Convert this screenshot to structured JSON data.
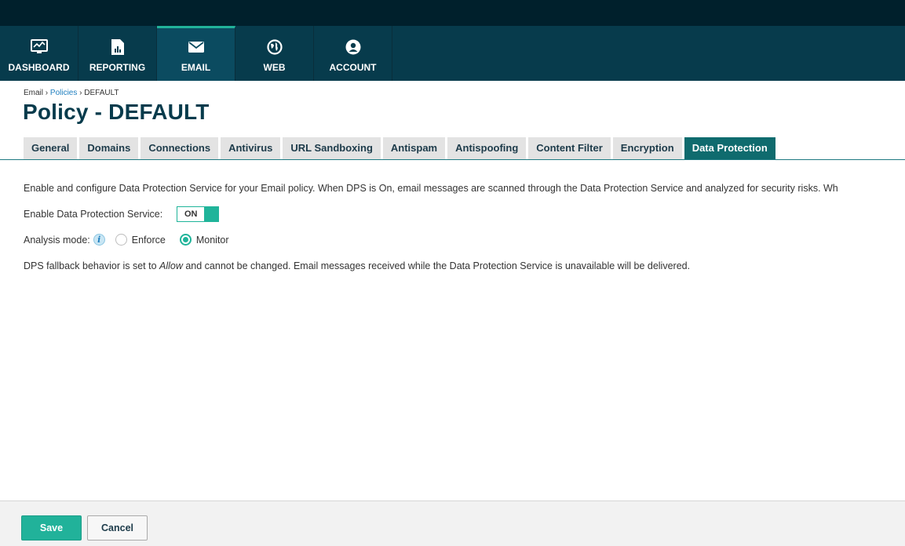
{
  "nav": {
    "items": [
      {
        "label": "DASHBOARD",
        "icon": "monitor-icon"
      },
      {
        "label": "REPORTING",
        "icon": "report-icon"
      },
      {
        "label": "EMAIL",
        "icon": "envelope-icon"
      },
      {
        "label": "WEB",
        "icon": "globe-icon"
      },
      {
        "label": "ACCOUNT",
        "icon": "user-icon"
      }
    ],
    "active": "EMAIL"
  },
  "breadcrumb": {
    "root": "Email",
    "sep1": " › ",
    "link": "Policies",
    "sep2": " › ",
    "current": "DEFAULT"
  },
  "title": "Policy - DEFAULT",
  "tabs": [
    "General",
    "Domains",
    "Connections",
    "Antivirus",
    "URL Sandboxing",
    "Antispam",
    "Antispoofing",
    "Content Filter",
    "Encryption",
    "Data Protection"
  ],
  "active_tab": "Data Protection",
  "content": {
    "intro": "Enable and configure Data Protection Service for your Email policy. When DPS is On, email messages are scanned through the Data Protection Service and analyzed for security risks. Wh",
    "enable_label": "Enable Data Protection Service:",
    "toggle_label": "ON",
    "analysis_label": "Analysis mode:",
    "info_glyph": "i",
    "mode_options": [
      "Enforce",
      "Monitor"
    ],
    "mode_selected": "Monitor",
    "fallback_pre": "DPS fallback behavior is set to ",
    "fallback_em": "Allow",
    "fallback_post": " and cannot be changed. Email messages received while the Data Protection Service is unavailable will be delivered."
  },
  "footer": {
    "save_label": "Save",
    "cancel_label": "Cancel"
  },
  "colors": {
    "nav_bg": "#073b4c",
    "top_strip": "#00202c",
    "accent": "#21b29a",
    "active_tab": "#0f6b6e",
    "title": "#073b4c",
    "link": "#1f7fbf"
  }
}
